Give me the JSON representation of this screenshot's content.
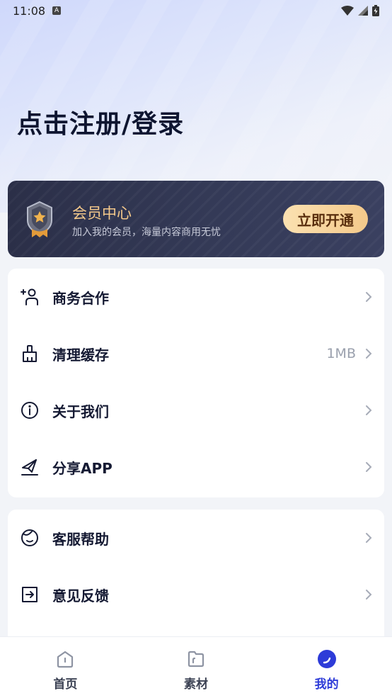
{
  "status_bar": {
    "time": "11:08",
    "notification_badge": "A"
  },
  "header": {
    "title": "点击注册/登录"
  },
  "vip": {
    "title": "会员中心",
    "description": "加入我的会员，海量内容商用无忧",
    "button_label": "立即开通"
  },
  "menu_group_1": [
    {
      "label": "商务合作",
      "value": "",
      "icon": "add-person-icon"
    },
    {
      "label": "清理缓存",
      "value": "1MB",
      "icon": "broom-icon"
    },
    {
      "label": "关于我们",
      "value": "",
      "icon": "info-icon"
    },
    {
      "label": "分享APP",
      "value": "",
      "icon": "share-icon"
    }
  ],
  "menu_group_2": [
    {
      "label": "客服帮助",
      "value": "",
      "icon": "smiley-icon"
    },
    {
      "label": "意见反馈",
      "value": "",
      "icon": "feedback-icon"
    }
  ],
  "tabs": [
    {
      "label": "首页",
      "icon": "home-icon",
      "active": false
    },
    {
      "label": "素材",
      "icon": "folder-icon",
      "active": false
    },
    {
      "label": "我的",
      "icon": "profile-icon",
      "active": true
    }
  ],
  "colors": {
    "accent": "#2d3bd8",
    "vip_gold": "#f5c98b",
    "vip_background": "#2b2f48",
    "title": "#0e1530"
  }
}
